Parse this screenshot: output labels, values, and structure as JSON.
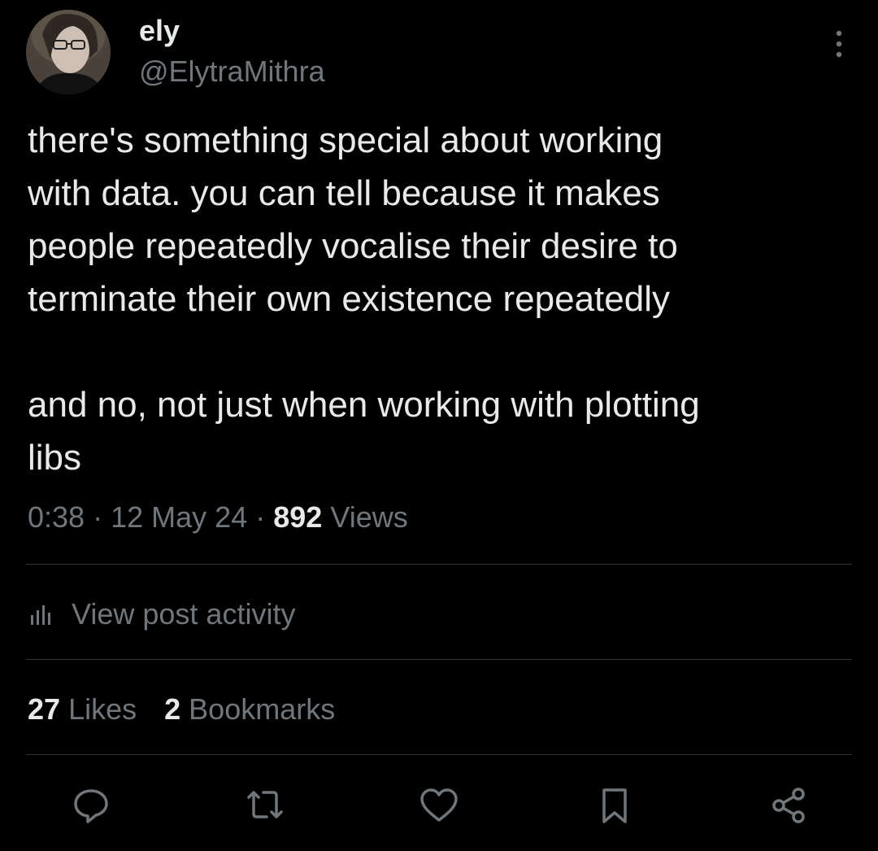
{
  "author": {
    "name": "ely",
    "handle": "@ElytraMithra"
  },
  "post": {
    "text": "there's something special about working\nwith data. you can tell because it makes\npeople repeatedly vocalise their desire to\nterminate their own existence repeatedly\n\nand no, not just when working with plotting\nlibs",
    "time": "0:38",
    "separator": "·",
    "date": "12 May 24",
    "views_count": "892",
    "views_label": "Views"
  },
  "activity": {
    "label": "View post activity",
    "icon": "bar-chart-icon"
  },
  "stats": {
    "likes_count": "27",
    "likes_label": "Likes",
    "bookmarks_count": "2",
    "bookmarks_label": "Bookmarks"
  },
  "actions": [
    {
      "icon": "reply-icon"
    },
    {
      "icon": "repost-icon"
    },
    {
      "icon": "like-icon"
    },
    {
      "icon": "bookmark-icon"
    },
    {
      "icon": "share-icon"
    }
  ],
  "colors": {
    "background": "#000000",
    "primary_text": "#e7e9ea",
    "secondary_text": "#71767b",
    "divider": "#2f3336"
  }
}
